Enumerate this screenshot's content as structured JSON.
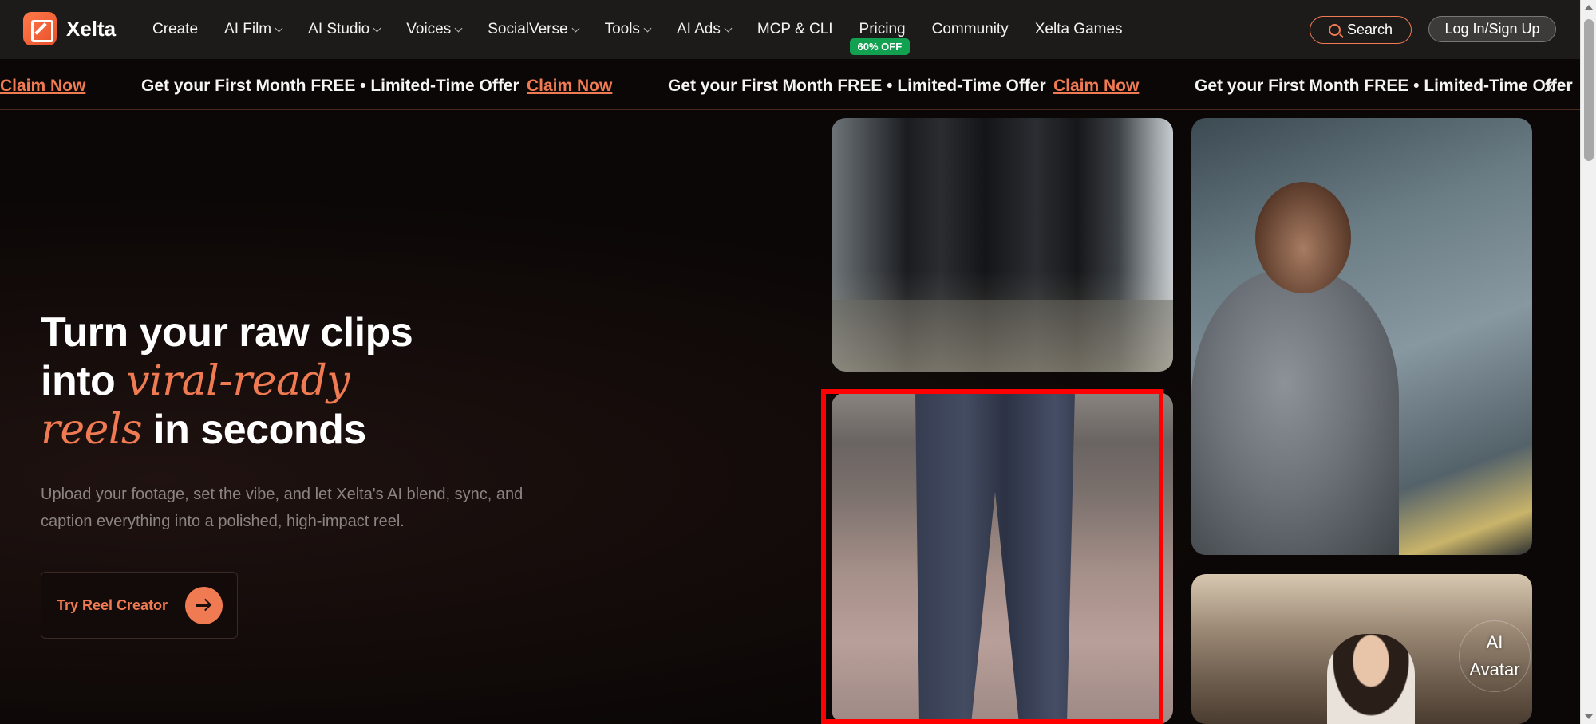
{
  "nav": {
    "logo_text": "Xelta",
    "items": [
      {
        "label": "Create",
        "has_dropdown": false
      },
      {
        "label": "AI Film",
        "has_dropdown": true
      },
      {
        "label": "AI Studio",
        "has_dropdown": true
      },
      {
        "label": "Voices",
        "has_dropdown": true
      },
      {
        "label": "SocialVerse",
        "has_dropdown": true
      },
      {
        "label": "Tools",
        "has_dropdown": true
      },
      {
        "label": "AI Ads",
        "has_dropdown": true
      },
      {
        "label": "MCP & CLI",
        "has_dropdown": false
      },
      {
        "label": "Pricing",
        "has_dropdown": false,
        "badge": "60% OFF"
      },
      {
        "label": "Community",
        "has_dropdown": false
      },
      {
        "label": "Xelta Games",
        "has_dropdown": false
      }
    ],
    "search_label": "Search",
    "login_label": "Log In/Sign Up"
  },
  "promo": {
    "claim_label": "Claim Now",
    "offer_text": "Get your First Month FREE • Limited-Time Offer",
    "close_icon": "×"
  },
  "hero": {
    "line1": "Turn your raw clips",
    "line2_plain": "into ",
    "line2_italic": "viral-ready",
    "line3_italic": "reels",
    "line3_plain": " in seconds",
    "subtitle": "Upload your footage, set the vibe, and let Xelta's AI blend, sync, and caption everything into a polished, high-impact reel.",
    "cta_label": "Try Reel Creator"
  },
  "media": {
    "ai_avatar_line1": "AI",
    "ai_avatar_line2": "Avatar"
  },
  "colors": {
    "accent": "#f07a52",
    "badge_green": "#12a150",
    "nav_bg": "#1c1b1a",
    "page_bg": "#0b0706",
    "highlight": "#ff0000"
  }
}
